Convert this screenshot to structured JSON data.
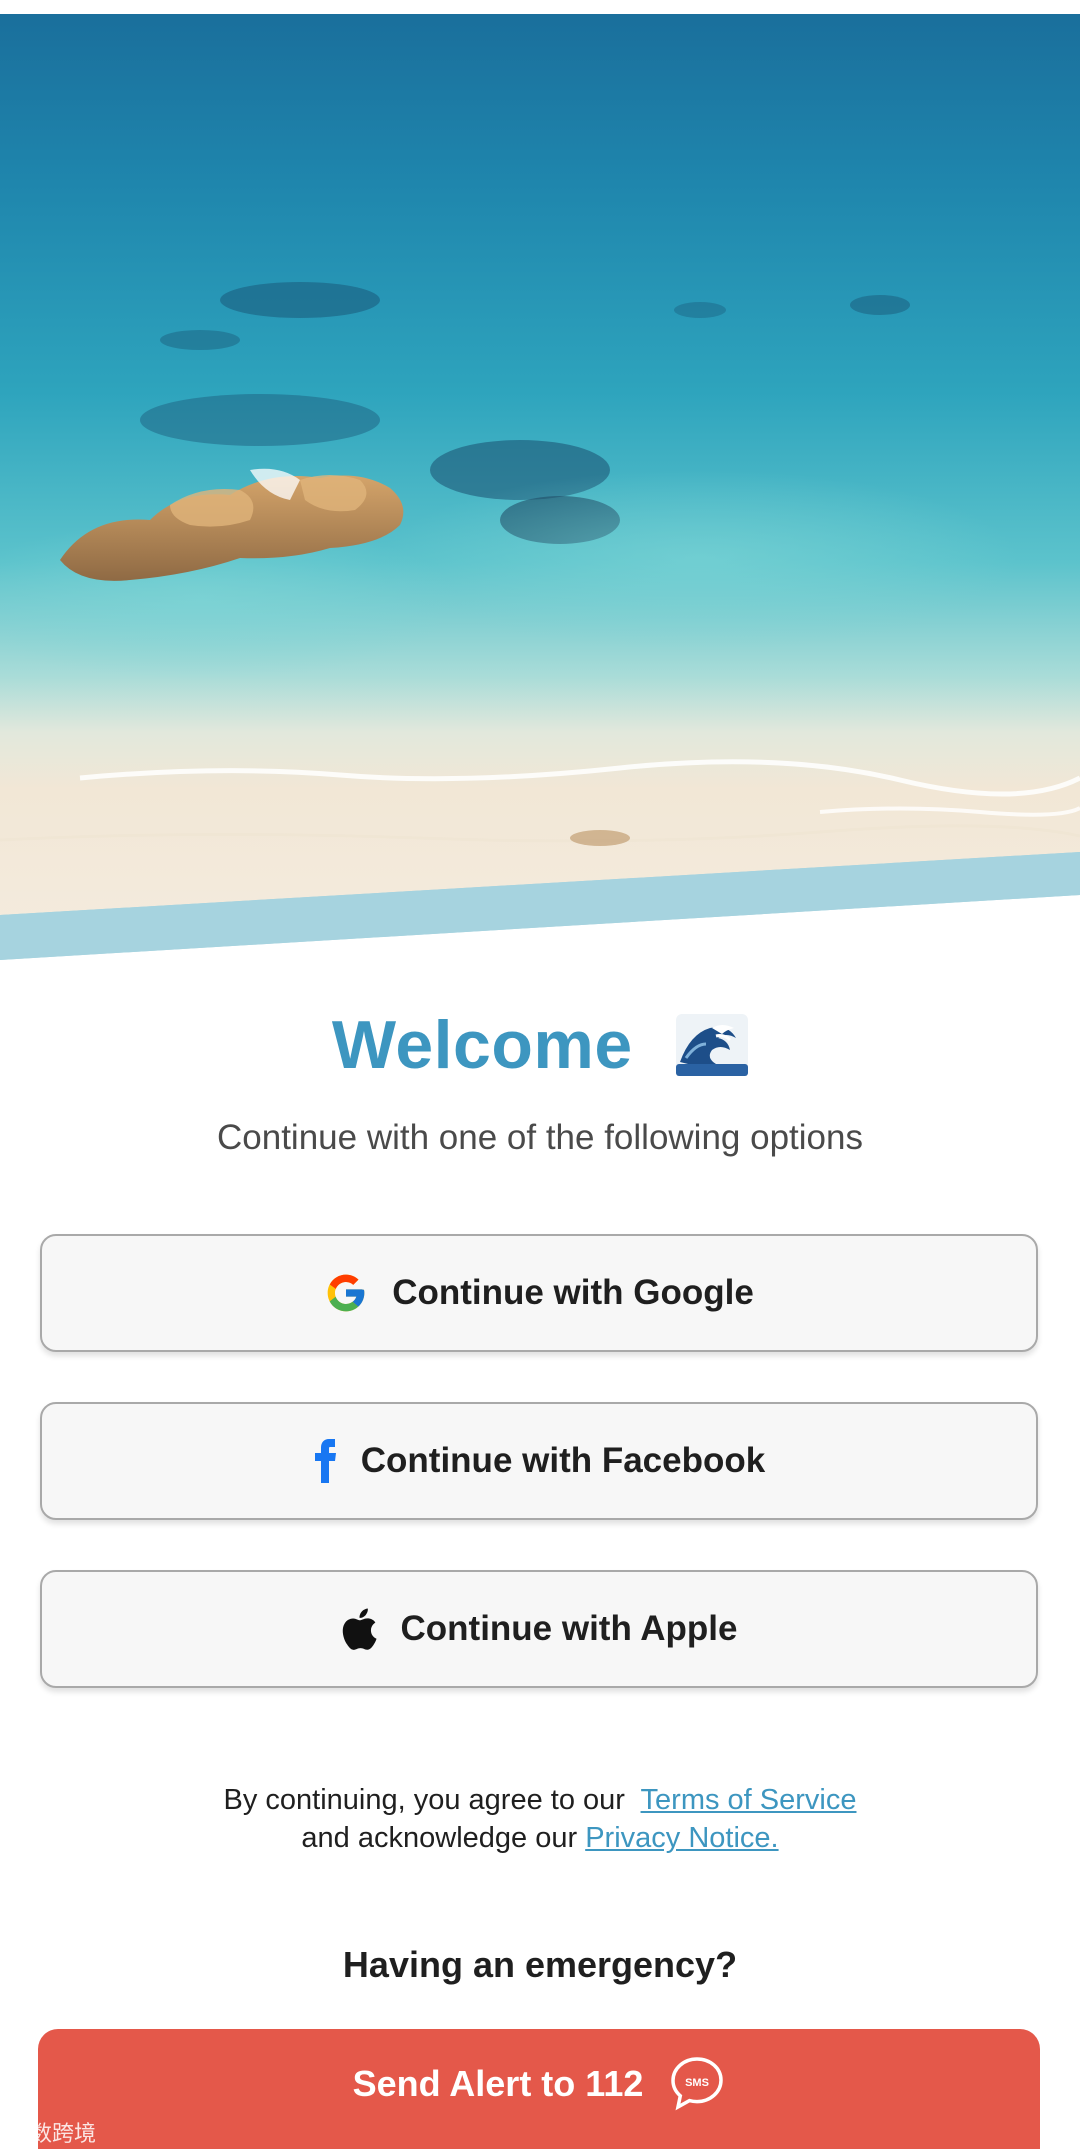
{
  "welcome": {
    "title": "Welcome",
    "subtitle": "Continue with one of the following options"
  },
  "auth": {
    "google_label": "Continue with Google",
    "facebook_label": "Continue with Facebook",
    "apple_label": "Continue with Apple"
  },
  "legal": {
    "prefix": "By continuing, you agree to our",
    "terms_link": "Terms of Service",
    "middle": "and acknowledge our",
    "privacy_link": "Privacy Notice."
  },
  "emergency": {
    "title": "Having an emergency?",
    "button_label": "Send Alert to 112",
    "sms_badge": "SMS"
  },
  "watermark": {
    "text": "大数跨境"
  },
  "icons": {
    "hero": "beach-photo",
    "emoji": "water-wave-icon",
    "google": "google-logo-icon",
    "facebook": "facebook-logo-icon",
    "apple": "apple-logo-icon",
    "sms": "sms-bubble-icon"
  },
  "colors": {
    "accent": "#3d96c0",
    "alert": "#e4584a",
    "button_bg": "#f7f7f7",
    "button_border": "#a9a9a9",
    "facebook": "#1877f2"
  }
}
